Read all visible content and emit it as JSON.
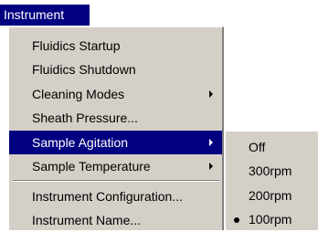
{
  "menubar": {
    "title": "Instrument"
  },
  "menu": {
    "items": [
      {
        "label": "Fluidics Startup"
      },
      {
        "label": "Fluidics Shutdown"
      },
      {
        "label": "Cleaning Modes"
      },
      {
        "label": "Sheath Pressure..."
      },
      {
        "label": "Sample Agitation"
      },
      {
        "label": "Sample Temperature"
      },
      {
        "label": "Instrument Configuration..."
      },
      {
        "label": "Instrument Name..."
      }
    ]
  },
  "submenu": {
    "items": [
      {
        "label": "Off"
      },
      {
        "label": "300rpm"
      },
      {
        "label": "200rpm"
      },
      {
        "label": "100rpm"
      }
    ]
  },
  "colors": {
    "highlight": "#000080",
    "menu_bg": "#d4d0c8"
  }
}
